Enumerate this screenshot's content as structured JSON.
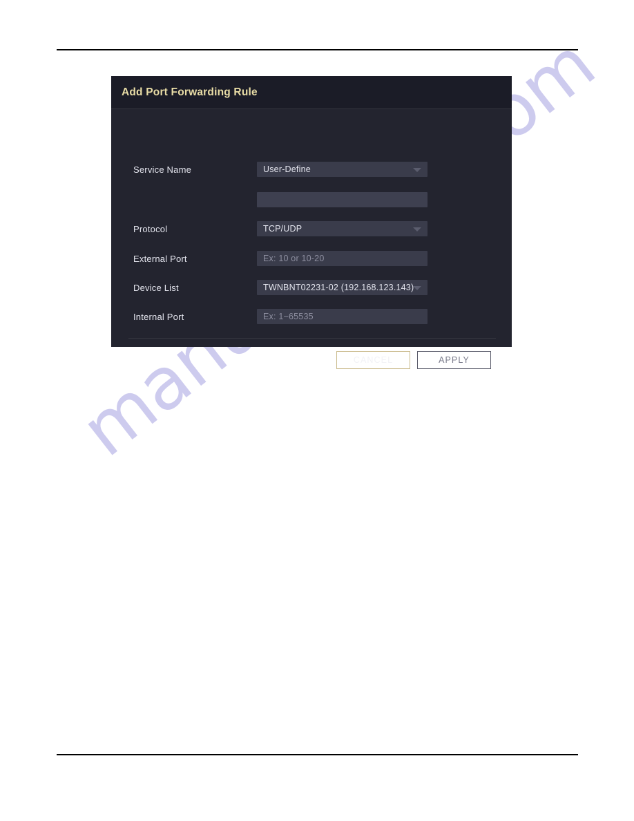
{
  "page": {
    "watermark": "manualshive.com",
    "background_color": "#ffffff",
    "rule_color": "#000000"
  },
  "dialog": {
    "title": "Add Port Forwarding Rule",
    "title_color": "#e9dda6",
    "background_color": "#23242f",
    "titlebar_color": "#1b1c27",
    "fields": [
      {
        "label": "Service Name",
        "type": "select",
        "value": "User-Define",
        "icon": "chevron-down-icon"
      },
      {
        "label": "",
        "type": "text",
        "value": "",
        "placeholder": ""
      },
      {
        "label": "Protocol",
        "type": "select",
        "value": "TCP/UDP",
        "icon": "chevron-down-icon"
      },
      {
        "label": "External Port",
        "type": "text",
        "value": "",
        "placeholder": "Ex: 10 or 10-20"
      },
      {
        "label": "Device List",
        "type": "select",
        "value": "TWNBNT02231-02 (192.168.123.143)",
        "icon": "chevron-down-icon"
      },
      {
        "label": "Internal Port",
        "type": "text",
        "value": "",
        "placeholder": "Ex: 1~65535"
      }
    ],
    "buttons": {
      "cancel": "CANCEL",
      "apply": "APPLY",
      "cancel_border_color": "#c9b98a",
      "apply_border_color": "#5a5b6a"
    }
  }
}
